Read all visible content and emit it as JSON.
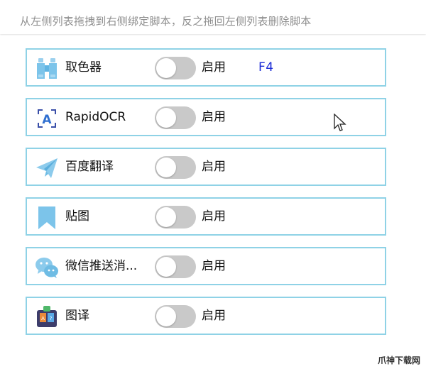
{
  "header": {
    "hint": "从左侧列表拖拽到右侧绑定脚本，反之拖回左侧列表删除脚本"
  },
  "scripts": [
    {
      "icon": "binoculars-icon",
      "name": "取色器",
      "toggle_on": false,
      "enable_label": "启用",
      "hotkey": "F4"
    },
    {
      "icon": "ocr-scan-icon",
      "name": "RapidOCR",
      "toggle_on": false,
      "enable_label": "启用"
    },
    {
      "icon": "paper-plane-icon",
      "name": "百度翻译",
      "toggle_on": false,
      "enable_label": "启用"
    },
    {
      "icon": "bookmark-icon",
      "name": "贴图",
      "toggle_on": false,
      "enable_label": "启用"
    },
    {
      "icon": "wechat-icon",
      "name": "微信推送消...",
      "toggle_on": false,
      "enable_label": "启用"
    },
    {
      "icon": "translate-app-icon",
      "name": "图译",
      "toggle_on": false,
      "enable_label": "启用"
    }
  ],
  "watermark": "爪神下载网",
  "colors": {
    "row_border": "#8fd2e6",
    "toggle_off": "#c9c9c9",
    "hotkey": "#1a2bd6",
    "hint_text": "#8f8f8f",
    "icon_blue": "#7cc4ea"
  }
}
